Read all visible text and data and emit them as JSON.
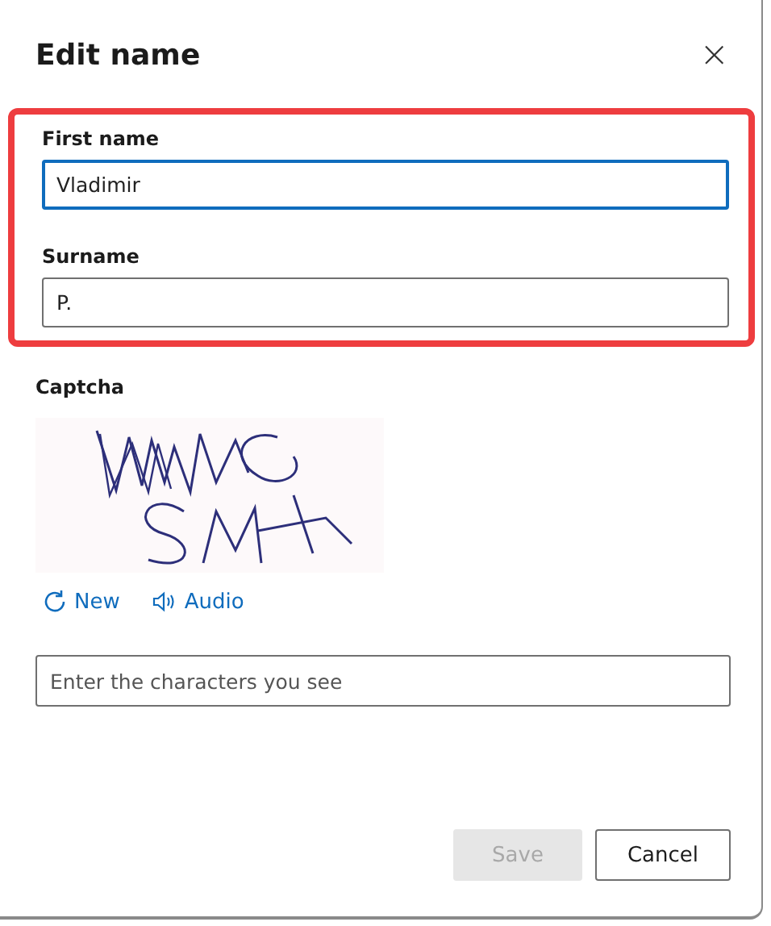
{
  "dialog": {
    "title": "Edit name",
    "close": "×"
  },
  "name_fields": {
    "highlighted": true,
    "fields": [
      {
        "label": "First name",
        "value": "Vladimir",
        "focused": true
      },
      {
        "label": "Surname",
        "value": "P.",
        "focused": false
      }
    ]
  },
  "captcha": {
    "label": "Captcha",
    "links": [
      {
        "kind": "refresh",
        "label": "New"
      },
      {
        "kind": "audio",
        "label": "Audio"
      }
    ],
    "input": {
      "placeholder": "Enter the characters you see"
    }
  },
  "buttons": [
    {
      "label": "Save",
      "disabled": true
    },
    {
      "label": "Cancel",
      "disabled": false
    }
  ]
}
